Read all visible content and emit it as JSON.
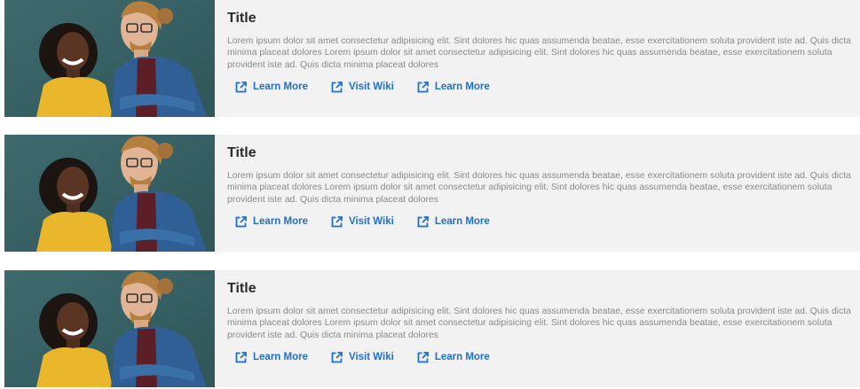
{
  "cards": [
    {
      "title": "Title",
      "body": "Lorem ipsum dolor sit amet consectetur adipisicing elit. Sint dolores hic quas assumenda beatae, esse exercitationem soluta provident iste ad. Quis dicta minima placeat dolores Lorem ipsum dolor sit amet consectetur adipisicing elit. Sint dolores hic quas assumenda beatae, esse exercitationem soluta provident iste ad. Quis dicta minima placeat dolores",
      "links": [
        {
          "label": "Learn More",
          "icon": "external-link-icon"
        },
        {
          "label": "Visit Wiki",
          "icon": "external-link-icon"
        },
        {
          "label": "Learn More",
          "icon": "external-link-icon"
        }
      ]
    },
    {
      "title": "Title",
      "body": "Lorem ipsum dolor sit amet consectetur adipisicing elit. Sint dolores hic quas assumenda beatae, esse exercitationem soluta provident iste ad. Quis dicta minima placeat dolores Lorem ipsum dolor sit amet consectetur adipisicing elit. Sint dolores hic quas assumenda beatae, esse exercitationem soluta provident iste ad. Quis dicta minima placeat dolores",
      "links": [
        {
          "label": "Learn More",
          "icon": "external-link-icon"
        },
        {
          "label": "Visit Wiki",
          "icon": "external-link-icon"
        },
        {
          "label": "Learn More",
          "icon": "external-link-icon"
        }
      ]
    },
    {
      "title": "Title",
      "body": "Lorem ipsum dolor sit amet consectetur adipisicing elit. Sint dolores hic quas assumenda beatae, esse exercitationem soluta provident iste ad. Quis dicta minima placeat dolores Lorem ipsum dolor sit amet consectetur adipisicing elit. Sint dolores hic quas assumenda beatae, esse exercitationem soluta provident iste ad. Quis dicta minima placeat dolores",
      "links": [
        {
          "label": "Learn More",
          "icon": "external-link-icon"
        },
        {
          "label": "Visit Wiki",
          "icon": "external-link-icon"
        },
        {
          "label": "Learn More",
          "icon": "external-link-icon"
        }
      ]
    }
  ],
  "colors": {
    "card_background": "#f2f2f2",
    "link": "#1f6fd1",
    "title": "#2b2b2b",
    "body_text": "#8a8a8a"
  }
}
